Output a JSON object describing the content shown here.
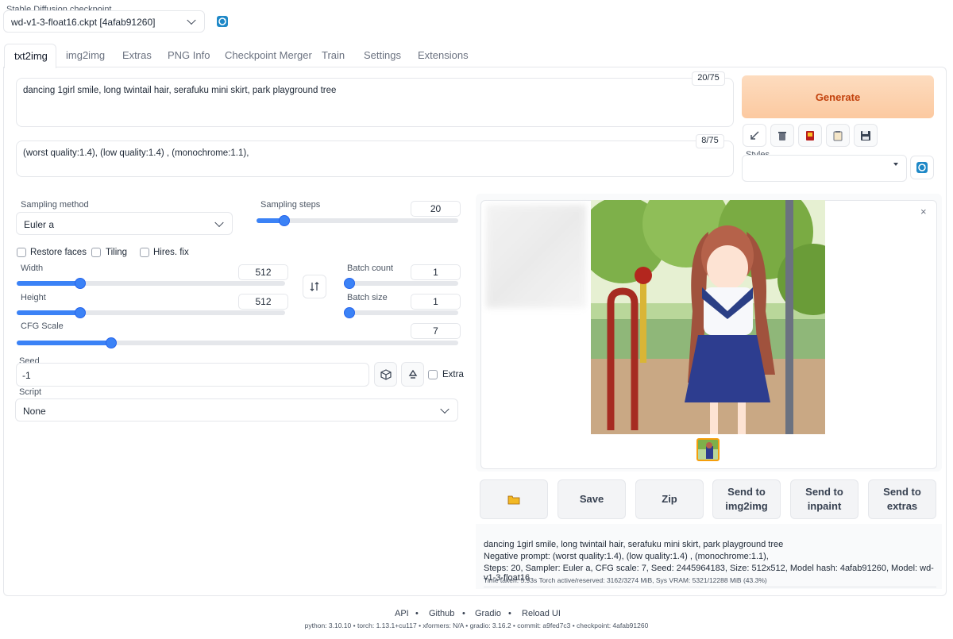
{
  "checkpoint": {
    "label": "Stable Diffusion checkpoint",
    "value": "wd-v1-3-float16.ckpt [4afab91260]"
  },
  "tabs": [
    "txt2img",
    "img2img",
    "Extras",
    "PNG Info",
    "Checkpoint Merger",
    "Train",
    "Settings",
    "Extensions"
  ],
  "prompt": {
    "value": "dancing 1girl smile, long twintail hair, serafuku mini skirt, park playground tree",
    "token_count": "20/75"
  },
  "negative_prompt": {
    "value": "(worst quality:1.4), (low quality:1.4) , (monochrome:1.1),",
    "token_count": "8/75"
  },
  "generate_label": "Generate",
  "styles_label": "Styles",
  "sampling": {
    "method_label": "Sampling method",
    "method": "Euler a",
    "steps_label": "Sampling steps",
    "steps": "20"
  },
  "options": {
    "restore_faces": "Restore faces",
    "tiling": "Tiling",
    "hires": "Hires. fix"
  },
  "width": {
    "label": "Width",
    "value": "512"
  },
  "height": {
    "label": "Height",
    "value": "512"
  },
  "batch_count": {
    "label": "Batch count",
    "value": "1"
  },
  "batch_size": {
    "label": "Batch size",
    "value": "1"
  },
  "cfg": {
    "label": "CFG Scale",
    "value": "7"
  },
  "seed": {
    "label": "Seed",
    "value": "-1",
    "extra_label": "Extra"
  },
  "script": {
    "label": "Script",
    "value": "None"
  },
  "output_buttons": {
    "save": "Save",
    "zip": "Zip",
    "send_img2img": "Send to img2img",
    "send_inpaint": "Send to inpaint",
    "send_extras": "Send to extras"
  },
  "info": {
    "prompt": "dancing 1girl smile, long twintail hair, serafuku mini skirt, park playground tree",
    "negative": "Negative prompt: (worst quality:1.4), (low quality:1.4) , (monochrome:1.1),",
    "params": "Steps: 20, Sampler: Euler a, CFG scale: 7, Seed: 2445964183, Size: 512x512, Model hash: 4afab91260, Model: wd-v1-3-float16",
    "time": "Time taken: 5.93s  Torch active/reserved: 3162/3274 MiB, Sys VRAM: 5321/12288 MiB (43.3%)"
  },
  "footer": {
    "links": [
      "API",
      "Github",
      "Gradio",
      "Reload UI"
    ],
    "versions": "python: 3.10.10  •  torch: 1.13.1+cu117  •  xformers: N/A  •  gradio: 3.16.2  •  commit: a9fed7c3  •  checkpoint: 4afab91260"
  },
  "colors": {
    "accent": "#3b82f6",
    "generate_bg": "#fcd3b0",
    "generate_text": "#c2410c"
  }
}
